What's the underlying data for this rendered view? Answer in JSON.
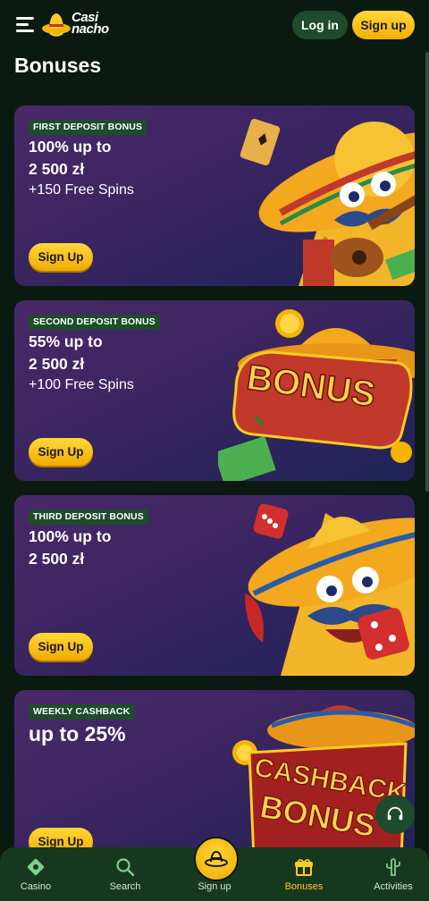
{
  "header": {
    "logo_line1": "Casi",
    "logo_line2": "nacho",
    "login_label": "Log in",
    "signup_label": "Sign up"
  },
  "page": {
    "title": "Bonuses"
  },
  "cards": [
    {
      "badge": "FIRST DEPOSIT BONUS",
      "line1": "100% up to",
      "line2": "2 500 zł",
      "line3": "+150 Free Spins",
      "button": "Sign Up"
    },
    {
      "badge": "SECOND DEPOSIT BONUS",
      "line1": "55% up to",
      "line2": "2 500 zł",
      "line3": "+100 Free Spins",
      "button": "Sign Up"
    },
    {
      "badge": "THIRD DEPOSIT BONUS",
      "line1": "100% up to",
      "line2": "2 500 zł",
      "button": "Sign Up"
    },
    {
      "badge": "WEEKLY CASHBACK",
      "headline": "up to 25%",
      "button": "Sign Up"
    }
  ],
  "art_text": {
    "bonus": "BONUS",
    "cashback": "CASHBACK",
    "bonus2": "BONUS"
  },
  "nav": {
    "casino": "Casino",
    "search": "Search",
    "signup": "Sign up",
    "bonuses": "Bonuses",
    "activities": "Activities"
  },
  "colors": {
    "accent": "#ffcc22",
    "bg": "#0b1a10",
    "badge": "#1d4d2a"
  }
}
